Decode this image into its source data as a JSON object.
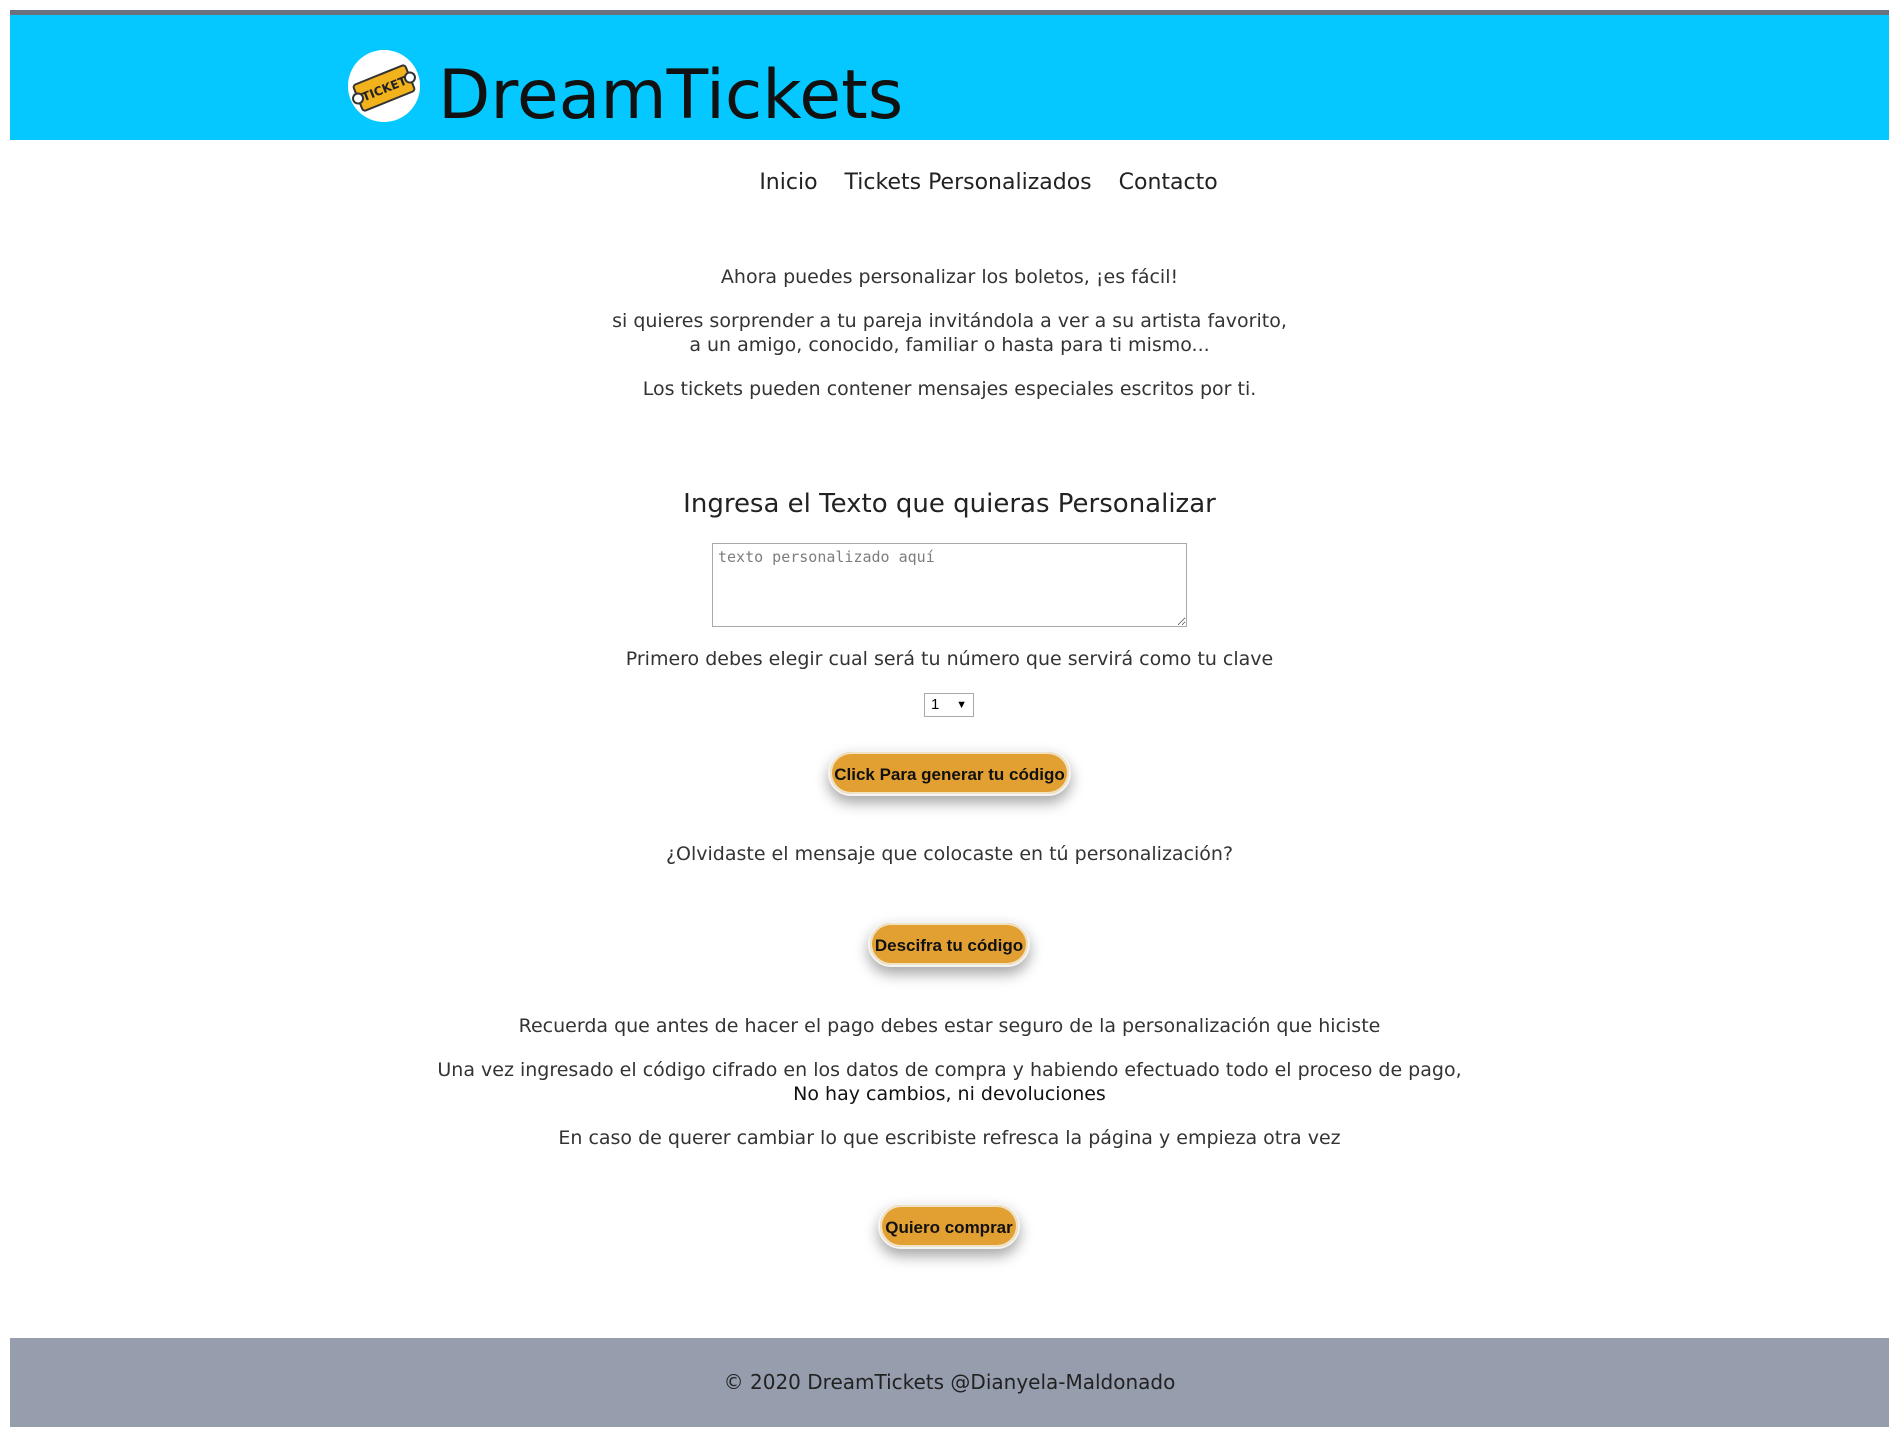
{
  "header": {
    "brand": "DreamTickets",
    "logo_text": "TICKET",
    "logo_icon": "ticket-icon"
  },
  "nav": {
    "items": [
      "Inicio",
      "Tickets Personalizados",
      "Contacto"
    ]
  },
  "intro": {
    "line1": "Ahora puedes personalizar los boletos, ¡es fácil!",
    "line2a": "si quieres sorprender a tu pareja invitándola a ver a su artista favorito,",
    "line2b": "a un amigo, conocido, familiar o hasta para ti mismo...",
    "line3": "Los tickets pueden contener mensajes especiales escritos por ti."
  },
  "form": {
    "heading": "Ingresa el Texto que quieras Personalizar",
    "textarea_placeholder": "texto personalizado aquí",
    "key_prompt": "Primero debes elegir cual será tu número que servirá como tu clave",
    "key_selected": "1",
    "generate_button": "Click Para generar tu código",
    "forgot_prompt": "¿Olvidaste el mensaje que colocaste en tú personalización?",
    "decrypt_button": "Descifra tu código"
  },
  "notes": {
    "line1": "Recuerda que antes de hacer el pago debes estar seguro de la personalización que hiciste",
    "line2a": "Una vez ingresado el código cifrado en los datos de compra y habiendo efectuado todo el proceso de pago,",
    "line2b": "No hay cambios, ni devoluciones",
    "line3": "En caso de querer cambiar lo que escribiste refresca la página y empieza otra vez",
    "buy_button": "Quiero comprar"
  },
  "footer": {
    "text": "© 2020 DreamTickets @Dianyela-Maldonado"
  },
  "colors": {
    "header_bg": "#04c8ff",
    "button_bg": "#e2a033",
    "footer_bg": "#969eae"
  }
}
